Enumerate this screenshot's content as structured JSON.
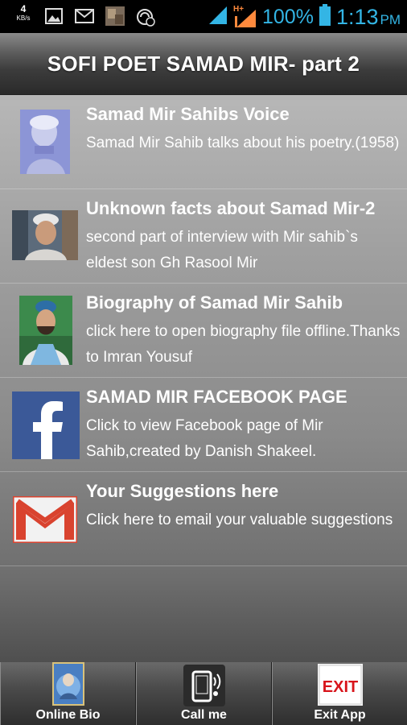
{
  "status_bar": {
    "net_speed_value": "4",
    "net_speed_unit": "KB/s",
    "network_type": "H+",
    "battery_percent": "100%",
    "time": "1:13",
    "ampm": "PM",
    "icons": [
      "image-icon",
      "gmail-icon",
      "app-thumbnail-icon",
      "sync-icon",
      "signal-icon",
      "data-signal-icon",
      "battery-icon"
    ]
  },
  "header": {
    "title": "SOFI POET SAMAD MIR- part 2"
  },
  "list": {
    "items": [
      {
        "title": "Samad Mir Sahibs Voice",
        "description": "Samad Mir Sahib talks about his poetry.(1958)",
        "icon": "portrait-photo"
      },
      {
        "title": "Unknown facts about Samad Mir-2",
        "description": "second part of interview with Mir sahib`s eldest son Gh Rasool Mir",
        "icon": "portrait-photo"
      },
      {
        "title": "Biography of Samad Mir Sahib",
        "description": "click here to open biography file offline.Thanks to Imran Yousuf",
        "icon": "portrait-photo"
      },
      {
        "title": "SAMAD MIR FACEBOOK PAGE",
        "description": "Click to view Facebook page of Mir Sahib,created by Danish Shakeel.",
        "icon": "facebook-icon"
      },
      {
        "title": "Your Suggestions here",
        "description": "Click here to email your valuable suggestions",
        "icon": "gmail-icon"
      }
    ]
  },
  "bottom_bar": {
    "buttons": [
      {
        "label": "Online Bio",
        "icon": "globe-portrait-icon"
      },
      {
        "label": "Call me",
        "icon": "phone-icon"
      },
      {
        "label": "Exit App",
        "icon": "exit-sign-icon"
      }
    ],
    "exit_icon_text": "EXIT"
  },
  "colors": {
    "status_accent": "#33b5e5",
    "facebook_blue": "#3b5998",
    "gmail_red": "#d9432f",
    "exit_red": "#d8141b"
  }
}
